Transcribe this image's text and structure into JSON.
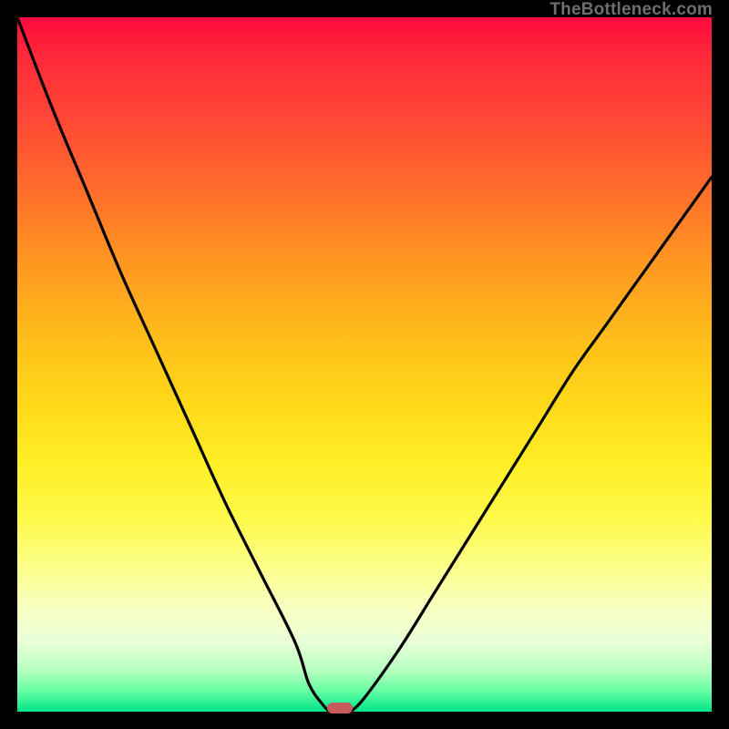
{
  "watermark": "TheBottleneck.com",
  "colors": {
    "curve": "#000000",
    "marker": "#c85c5c",
    "background_black": "#000000"
  },
  "chart_data": {
    "type": "line",
    "title": "",
    "xlabel": "",
    "ylabel": "",
    "xlim": [
      0,
      100
    ],
    "ylim": [
      0,
      100
    ],
    "grid": false,
    "legend": false,
    "series": [
      {
        "name": "left-curve",
        "x": [
          0,
          5,
          10,
          15,
          20,
          25,
          30,
          35,
          40,
          42,
          44,
          45
        ],
        "y": [
          100,
          87,
          75,
          63,
          52,
          41,
          30,
          20,
          10,
          4,
          1,
          0
        ]
      },
      {
        "name": "right-curve",
        "x": [
          48,
          50,
          55,
          60,
          65,
          70,
          75,
          80,
          85,
          90,
          95,
          100
        ],
        "y": [
          0,
          2,
          9,
          17,
          25,
          33,
          41,
          49,
          56,
          63,
          70,
          77
        ]
      }
    ],
    "annotations": [
      {
        "name": "minimum-marker",
        "x": 46.5,
        "y": 0.5
      }
    ]
  }
}
